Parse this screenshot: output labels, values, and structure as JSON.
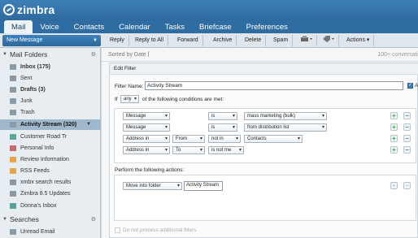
{
  "app": {
    "logo_text": "zimbra"
  },
  "tabs": [
    {
      "label": "Mail",
      "active": true
    },
    {
      "label": "Voice"
    },
    {
      "label": "Contacts"
    },
    {
      "label": "Calendar"
    },
    {
      "label": "Tasks"
    },
    {
      "label": "Briefcase"
    },
    {
      "label": "Preferences"
    }
  ],
  "toolbar": {
    "new_message": "New Message",
    "reply": "Reply",
    "reply_all": "Reply to All",
    "forward": "Forward",
    "archive": "Archive",
    "delete": "Delete",
    "spam": "Spam",
    "actions": "Actions"
  },
  "sidebar": {
    "mail_folders_label": "Mail Folders",
    "folders": [
      {
        "label": "Inbox (175)",
        "bold": true
      },
      {
        "label": "Sent"
      },
      {
        "label": "Drafts (3)",
        "bold": true
      },
      {
        "label": "Junk"
      },
      {
        "label": "Trash"
      },
      {
        "label": "Activity Stream (320)",
        "selected": true
      },
      {
        "label": "Customer Road Tr"
      },
      {
        "label": "Personal Info"
      },
      {
        "label": "Review Information"
      },
      {
        "label": "RSS Feeds"
      },
      {
        "label": "xmbx search results"
      },
      {
        "label": "Zimbra 8.5 Updates"
      },
      {
        "label": "Donna's Inbox"
      }
    ],
    "searches_label": "Searches",
    "searches": [
      {
        "label": "Unread Email"
      }
    ]
  },
  "main": {
    "sorted_by": "Sorted by Date",
    "conversation_count": "100+ conversati"
  },
  "dialog": {
    "title": "Edit Filter",
    "filter_name_label": "Filter Name:",
    "filter_name_value": "Activity Stream",
    "active_label": "Ac",
    "if_label": "If",
    "match_value": "any",
    "conditions_suffix": "of the following conditions are met:",
    "conditions": [
      {
        "field": "Message",
        "sub": "",
        "op": "is",
        "value": "mass marketing (bulk)"
      },
      {
        "field": "Message",
        "sub": "",
        "op": "is",
        "value": "from distribution list"
      },
      {
        "field": "Address in",
        "sub": "From",
        "op": "not in",
        "value": "Contacts"
      },
      {
        "field": "Address in",
        "sub": "To",
        "op": "is not me",
        "value": ""
      }
    ],
    "actions_label": "Perform the following actions:",
    "action": {
      "type": "Move into folder",
      "folder": "Activity Stream"
    },
    "no_further_label": "Do not process additional filters"
  },
  "colors": {
    "header_blue": "#2f6ca2",
    "selected_folder": "#9fb8cc",
    "plus_green": "#3ea04a",
    "minus_blue": "#3a8ac8"
  }
}
